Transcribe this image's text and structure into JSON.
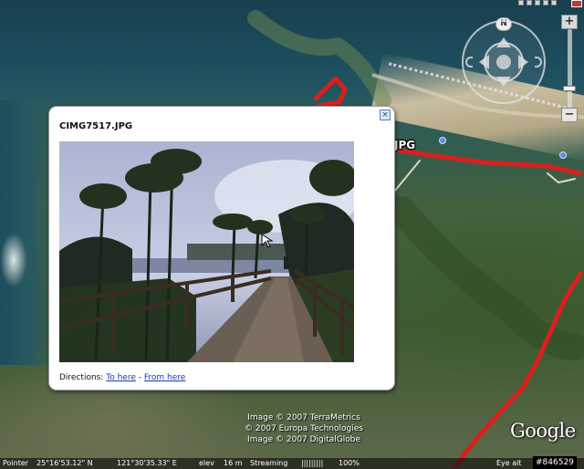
{
  "balloon": {
    "title": "CIMG7517.JPG",
    "close_icon": "close-icon",
    "directions_label": "Directions:",
    "to_here": "To here",
    "separator": "-",
    "from_here": "From here"
  },
  "map": {
    "placemark_label": "JPG",
    "north_label": "N",
    "zoom_in": "+",
    "zoom_out": "−",
    "zoom_level": 0.78,
    "route_color": "#d8201e"
  },
  "credits": {
    "line1": "Image © 2007 TerraMetrics",
    "line2": "© 2007 Europa Technologies",
    "line3": "Image © 2007 DigitalGlobe"
  },
  "logo": "Google",
  "status": {
    "pointer_label": "Pointer",
    "lat": "25°16'53.12\" N",
    "lon": "121°30'35.33\" E",
    "elev_label": "elev",
    "elev_value": "16 m",
    "streaming_label": "Streaming",
    "streaming_bar": "|||||||||",
    "streaming_percent": "100%",
    "eye_alt_label": "Eye alt"
  },
  "watermark": "#846529"
}
